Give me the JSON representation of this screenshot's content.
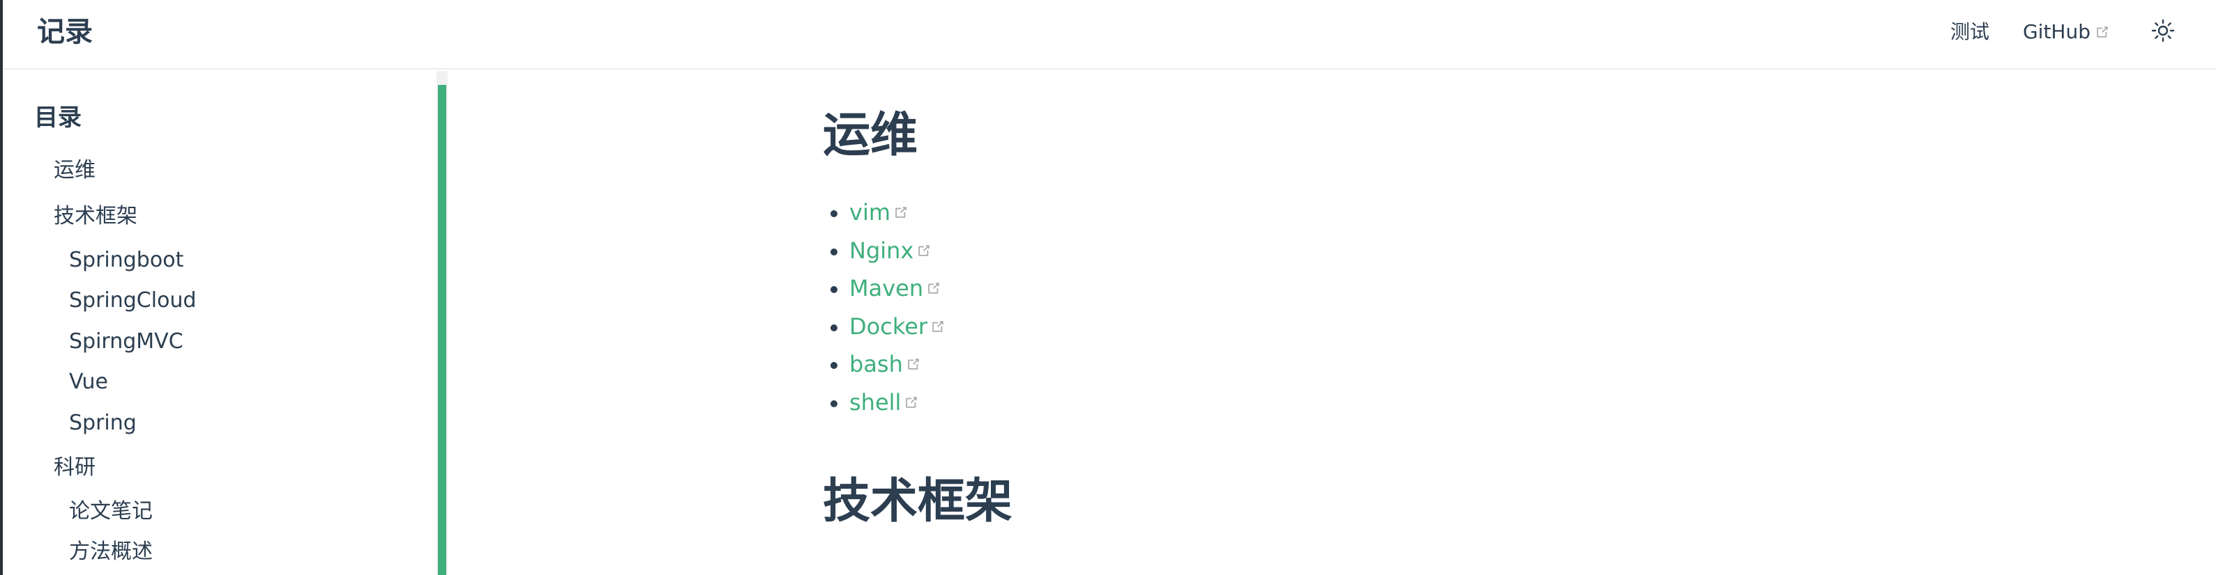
{
  "site": {
    "title": "记录"
  },
  "navbar": {
    "links": [
      {
        "label": "测试",
        "external": false
      },
      {
        "label": "GitHub",
        "external": true
      }
    ],
    "theme_icon": "sun-icon"
  },
  "sidebar": {
    "heading": "目录",
    "items": [
      {
        "label": "运维",
        "level": 1
      },
      {
        "label": "技术框架",
        "level": 1
      },
      {
        "label": "Springboot",
        "level": 2
      },
      {
        "label": "SpringCloud",
        "level": 2
      },
      {
        "label": "SpirngMVC",
        "level": 2
      },
      {
        "label": "Vue",
        "level": 2
      },
      {
        "label": "Spring",
        "level": 2
      },
      {
        "label": "科研",
        "level": 1
      },
      {
        "label": "论文笔记",
        "level": 2
      },
      {
        "label": "方法概述",
        "level": 2
      }
    ]
  },
  "content": {
    "sections": [
      {
        "heading": "运维",
        "links": [
          "vim",
          "Nginx",
          "Maven",
          "Docker",
          "bash",
          "shell"
        ]
      },
      {
        "heading": "技术框架",
        "links": []
      }
    ]
  },
  "colors": {
    "accent": "#3eaf7c",
    "text": "#2c3e50",
    "border": "#eaecef"
  }
}
